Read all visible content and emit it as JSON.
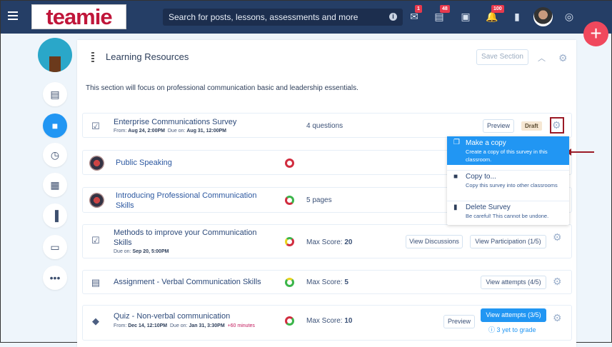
{
  "header": {
    "logo": "teamie",
    "search_placeholder": "Search for posts, lessons, assessments and more",
    "badges": {
      "messages": "1",
      "posts": "48",
      "notifications": "100"
    }
  },
  "fab": "+",
  "section": {
    "title": "Learning Resources",
    "save_label": "Save Section",
    "description": "This section will focus on professional communication basic and leadership essentials."
  },
  "items": [
    {
      "title": "Enterprise Communications Survey",
      "from_label": "From:",
      "from": "Aug 24, 2:00PM",
      "due_label": "Due on:",
      "due": "Aug 31, 12:00PM",
      "info": "4 questions",
      "preview": "Preview",
      "status": "Draft"
    },
    {
      "title": "Public Speaking"
    },
    {
      "title": "Introducing Professional Communication Skills",
      "info": "5 pages"
    },
    {
      "title": "Methods to improve your Communication Skills",
      "due_label": "Due on:",
      "due": "Sep 20, 5:00PM",
      "score_label": "Max Score:",
      "score": "20",
      "btn1": "View Discussions",
      "btn2": "View Participation (1/5)"
    },
    {
      "title": "Assignment - Verbal Communication Skills",
      "score_label": "Max Score:",
      "score": "5",
      "btn1": "View attempts (4/5)"
    },
    {
      "title": "Quiz - Non-verbal communication",
      "from_label": "From:",
      "from": "Dec 14, 12:10PM",
      "due_label": "Due on:",
      "due": "Jan 31, 3:30PM",
      "extra": "+60 minutes",
      "score_label": "Max Score:",
      "score": "10",
      "preview": "Preview",
      "btn1": "View attempts (3/5)",
      "to_grade": "3 yet to grade"
    }
  ],
  "menu": [
    {
      "label": "Make a copy",
      "desc": "Create a copy of this survey in this classroom."
    },
    {
      "label": "Copy to...",
      "desc": "Copy this survey into other classrooms"
    },
    {
      "label": "Delete Survey",
      "desc": "Be careful! This cannot be undone."
    }
  ]
}
